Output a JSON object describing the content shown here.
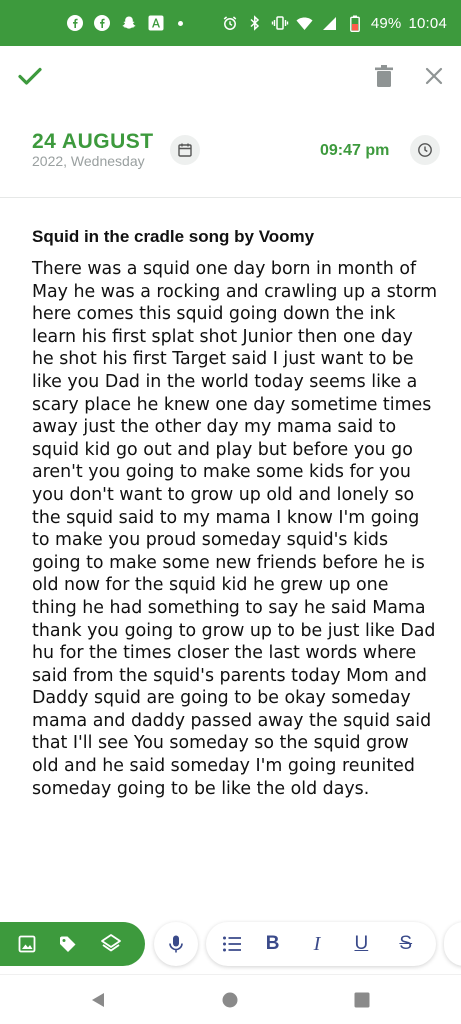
{
  "status_bar": {
    "battery": "49%",
    "time": "10:04"
  },
  "top_bar": {
    "icons": [
      "check-icon",
      "trash-icon",
      "close-icon"
    ]
  },
  "date": {
    "day_month": "24 AUGUST",
    "year_weekday": "2022, Wednesday",
    "time": "09:47 pm"
  },
  "note": {
    "title": "Squid in the cradle song by Voomy",
    "body": "There was a squid one day born in month of May he was a rocking and  crawling up a storm here comes this squid going down the ink learn his first splat shot Junior then one day he shot his first Target said I just want to be like you Dad  in the world today seems like a scary place  he knew one day sometime times away just the other day my mama said  to squid kid go out and play but before you go aren't you going to make some kids  for you you don't want to grow up old and  lonely so the squid said to my mama  I know I'm going to make you proud someday squid's  kids going to make some new  friends before he is old now for the  squid kid he  grew up one thing he had something to say he said Mama thank you going to grow up to be just like Dad hu  for the times closer  the last words  where said from the squid's parents today  Mom and Daddy squid are going to be okay someday mama and daddy passed away the squid said that I'll see You someday so the squid grow old and he said someday I'm going reunited someday going to be like the old days."
  },
  "toolbar": {
    "format_labels": {
      "bold": "B",
      "italic": "I",
      "underline": "U",
      "strike": "S"
    }
  },
  "colors": {
    "accent": "#3d9a3d",
    "format_icon": "#3a4a8a",
    "muted_text": "#9aa0a0"
  }
}
